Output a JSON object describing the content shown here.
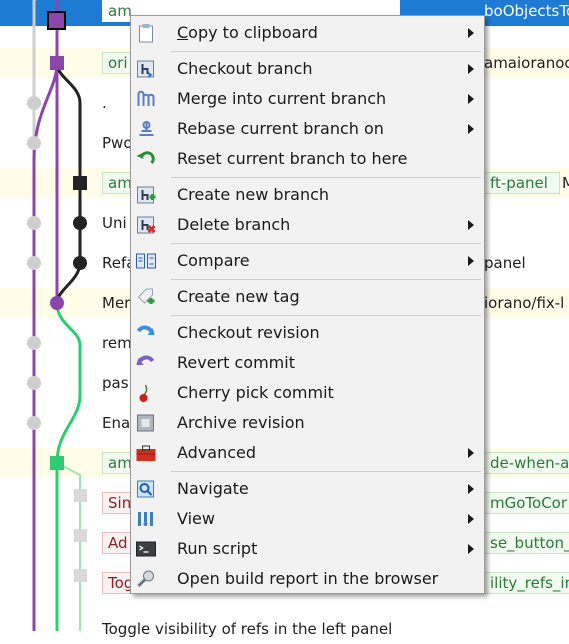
{
  "rows": [
    {
      "text": "",
      "refs": [
        {
          "label": "am",
          "style": "white"
        }
      ],
      "tail": "boObjectsTo",
      "tail_style": "white",
      "selected": true
    },
    {
      "text": "",
      "refs": [
        {
          "label": "ori",
          "style": "green"
        }
      ],
      "tail": "amaioranoc",
      "tail_style": "dark",
      "alt": true
    },
    {
      "text": ".",
      "refs": [],
      "tail": ""
    },
    {
      "text": "Pwo",
      "refs": [],
      "tail": ""
    },
    {
      "text": "",
      "refs": [
        {
          "label": "am",
          "style": "green"
        },
        {
          "label": "ft-panel",
          "style": "green"
        }
      ],
      "tail": "M",
      "tail_style": "dark",
      "alt": true
    },
    {
      "text": "Uni",
      "refs": [],
      "tail": ""
    },
    {
      "text": "Refa",
      "refs": [],
      "tail": "panel",
      "tail_style": "dark"
    },
    {
      "text": "Mer",
      "refs": [],
      "tail": "iorano/fix-l",
      "tail_style": "dark",
      "alt": true
    },
    {
      "text": "rem",
      "refs": [],
      "tail": ""
    },
    {
      "text": "pas",
      "refs": [],
      "tail": ""
    },
    {
      "text": "Ena",
      "refs": [],
      "tail": ""
    },
    {
      "text": "",
      "refs": [
        {
          "label": "am",
          "style": "green"
        }
      ],
      "tail": "de-when-ah",
      "tail_style": "green-ref",
      "alt": true
    },
    {
      "text": "",
      "refs": [
        {
          "label": "Sin",
          "style": "red"
        }
      ],
      "tail": "mGoToCor",
      "tail_style": "green-ref"
    },
    {
      "text": "",
      "refs": [
        {
          "label": "Ad",
          "style": "red"
        }
      ],
      "tail": "se_button_",
      "tail_style": "green-ref"
    },
    {
      "text": "",
      "refs": [
        {
          "label": "Tog",
          "style": "red"
        }
      ],
      "tail": "ility_refs_in",
      "tail_style": "green-ref"
    },
    {
      "text": "Toggle visibility of refs in the left panel",
      "refs": [],
      "tail": ""
    }
  ],
  "menu": {
    "items": [
      {
        "label": "Copy to clipboard",
        "icon": "clipboard-icon",
        "submenu": true,
        "underline": "C"
      },
      {
        "sep": true
      },
      {
        "label": "Checkout branch",
        "icon": "checkout-branch-icon",
        "submenu": true
      },
      {
        "label": "Merge into current branch",
        "icon": "merge-icon",
        "submenu": true
      },
      {
        "label": "Rebase current branch on",
        "icon": "rebase-icon",
        "submenu": true
      },
      {
        "label": "Reset current branch to here",
        "icon": "reset-icon",
        "submenu": false
      },
      {
        "sep": true
      },
      {
        "label": "Create new branch",
        "icon": "create-branch-icon",
        "submenu": false
      },
      {
        "label": "Delete branch",
        "icon": "delete-branch-icon",
        "submenu": true
      },
      {
        "sep": true
      },
      {
        "label": "Compare",
        "icon": "compare-icon",
        "submenu": true
      },
      {
        "sep": true
      },
      {
        "label": "Create new tag",
        "icon": "tag-icon",
        "submenu": false
      },
      {
        "sep": true
      },
      {
        "label": "Checkout revision",
        "icon": "checkout-revision-icon",
        "submenu": false
      },
      {
        "label": "Revert commit",
        "icon": "revert-icon",
        "submenu": false
      },
      {
        "label": "Cherry pick commit",
        "icon": "cherry-icon",
        "submenu": false
      },
      {
        "label": "Archive revision",
        "icon": "archive-icon",
        "submenu": false
      },
      {
        "label": "Advanced",
        "icon": "toolbox-icon",
        "submenu": true
      },
      {
        "sep": true
      },
      {
        "label": "Navigate",
        "icon": "navigate-icon",
        "submenu": true
      },
      {
        "label": "View",
        "icon": "view-icon",
        "submenu": true
      },
      {
        "label": "Run script",
        "icon": "console-icon",
        "submenu": true
      },
      {
        "label": "Open build report in the browser",
        "icon": "build-report-icon",
        "submenu": false
      }
    ]
  },
  "colors": {
    "selection": "#1e7bd4",
    "alt_row": "#fffde8",
    "graph_purple": "#8e44ad",
    "graph_green": "#2ecc71",
    "graph_black": "#222222",
    "graph_grey": "#cfcfcf"
  }
}
